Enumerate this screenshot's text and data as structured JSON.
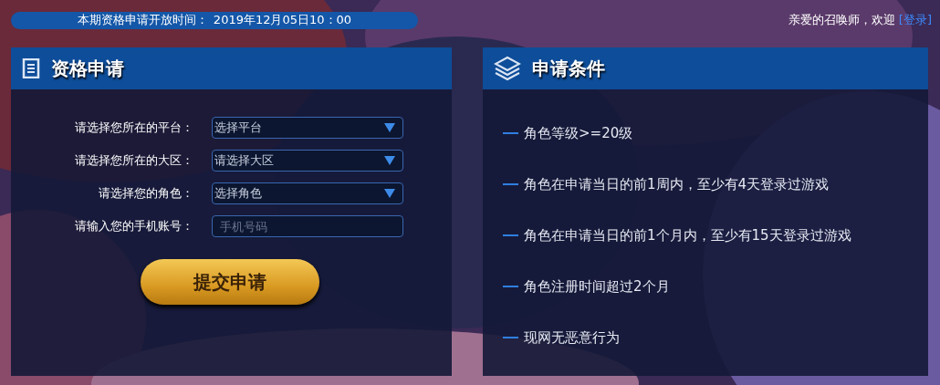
{
  "notice": {
    "label": "本期资格申请开放时间：",
    "time": "2019年12月05日10：00"
  },
  "greeting": {
    "text": "亲爱的召唤师，欢迎",
    "link": "[登录]"
  },
  "apply_panel": {
    "title": "资格申请",
    "fields": [
      {
        "kind": "select",
        "label": "请选择您所在的平台：",
        "value": "选择平台"
      },
      {
        "kind": "select",
        "label": "请选择您所在的大区：",
        "value": "请选择大区"
      },
      {
        "kind": "select",
        "label": "请选择您的角色：",
        "value": "选择角色"
      },
      {
        "kind": "input",
        "label": "请输入您的手机账号：",
        "placeholder": "手机号码"
      }
    ],
    "submit": "提交申请"
  },
  "conditions_panel": {
    "title": "申请条件",
    "items": [
      "角色等级>=20级",
      "角色在申请当日的前1周内，至少有4天登录过游戏",
      "角色在申请当日的前1个月内，至少有15天登录过游戏",
      "角色注册时间超过2个月",
      "现网无恶意行为"
    ]
  }
}
